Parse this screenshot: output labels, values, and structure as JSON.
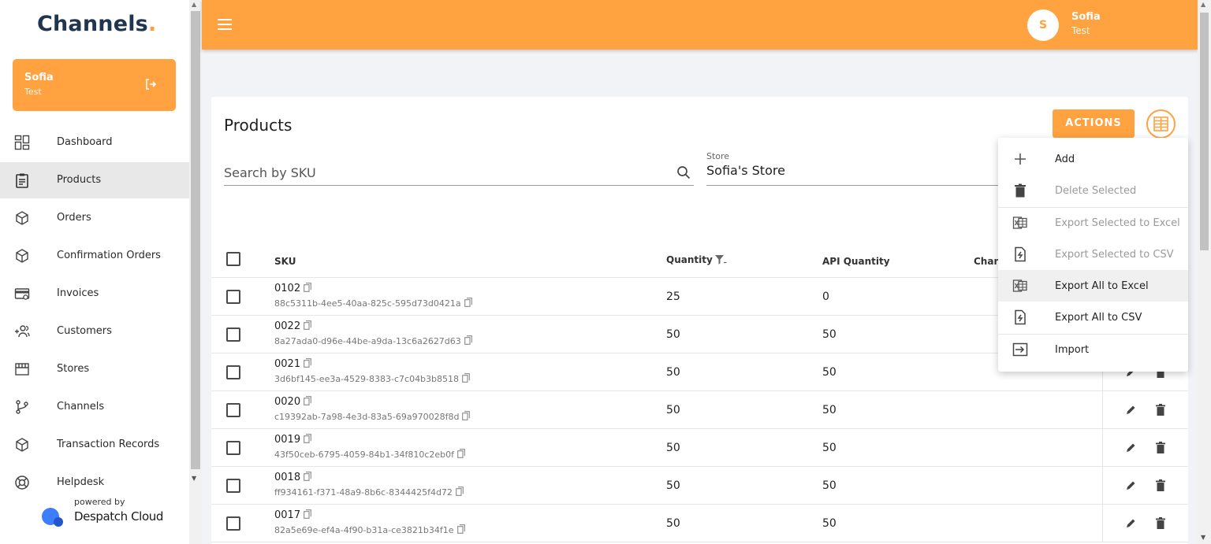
{
  "brand": {
    "name": "Channels",
    "dot": "."
  },
  "user": {
    "name": "Sofia",
    "subtitle": "Test",
    "initial": "S"
  },
  "sidebar": {
    "items": [
      {
        "label": "Dashboard",
        "icon": "dashboard-icon"
      },
      {
        "label": "Products",
        "icon": "clipboard-icon",
        "active": true
      },
      {
        "label": "Orders",
        "icon": "box-icon"
      },
      {
        "label": "Confirmation Orders",
        "icon": "box-icon"
      },
      {
        "label": "Invoices",
        "icon": "card-icon"
      },
      {
        "label": "Customers",
        "icon": "add-user-icon"
      },
      {
        "label": "Stores",
        "icon": "store-icon"
      },
      {
        "label": "Channels",
        "icon": "branch-icon"
      },
      {
        "label": "Transaction Records",
        "icon": "box-icon"
      },
      {
        "label": "Helpdesk",
        "icon": "lifebuoy-icon"
      }
    ],
    "powered_by": "powered by",
    "powered_brand": "Despatch Cloud"
  },
  "page": {
    "title": "Products",
    "actions_label": "ACTIONS",
    "search_placeholder": "Search by SKU",
    "store_label": "Store",
    "store_value": "Sofia's Store"
  },
  "table": {
    "headers": {
      "sku": "SKU",
      "quantity": "Quantity",
      "api_quantity": "API Quantity",
      "channels": "Chan"
    },
    "rows": [
      {
        "sku": "0102",
        "uuid": "88c5311b-4ee5-40aa-825c-595d73d0421a",
        "quantity": "25",
        "api_quantity": "0"
      },
      {
        "sku": "0022",
        "uuid": "8a27ada0-d96e-44be-a9da-13c6a2627d63",
        "quantity": "50",
        "api_quantity": "50"
      },
      {
        "sku": "0021",
        "uuid": "3d6bf145-ee3a-4529-8383-c7c04b3b8518",
        "quantity": "50",
        "api_quantity": "50"
      },
      {
        "sku": "0020",
        "uuid": "c19392ab-7a98-4e3d-83a5-69a970028f8d",
        "quantity": "50",
        "api_quantity": "50"
      },
      {
        "sku": "0019",
        "uuid": "43f50ceb-6795-4059-84b1-34f810c2eb0f",
        "quantity": "50",
        "api_quantity": "50"
      },
      {
        "sku": "0018",
        "uuid": "ff934161-f371-48a9-8b6c-8344425f4d72",
        "quantity": "50",
        "api_quantity": "50"
      },
      {
        "sku": "0017",
        "uuid": "82a5e69e-ef4a-4f90-b31a-ce3821b34f1e",
        "quantity": "50",
        "api_quantity": "50"
      }
    ]
  },
  "actions_menu": {
    "items": [
      {
        "label": "Add",
        "icon": "plus-icon",
        "disabled": false
      },
      {
        "label": "Delete Selected",
        "icon": "trash-icon",
        "disabled": true
      },
      {
        "label": "Export Selected to Excel",
        "icon": "excel-icon",
        "disabled": true
      },
      {
        "label": "Export Selected to CSV",
        "icon": "csv-icon",
        "disabled": true
      },
      {
        "label": "Export All to Excel",
        "icon": "excel-icon",
        "disabled": false,
        "hovered": true
      },
      {
        "label": "Export All to CSV",
        "icon": "csv-icon",
        "disabled": false
      },
      {
        "label": "Import",
        "icon": "import-icon",
        "disabled": false
      }
    ]
  },
  "colors": {
    "accent": "#ffa23f",
    "brand_text": "#1f3550",
    "sidebar_active": "#e8e8e8"
  }
}
